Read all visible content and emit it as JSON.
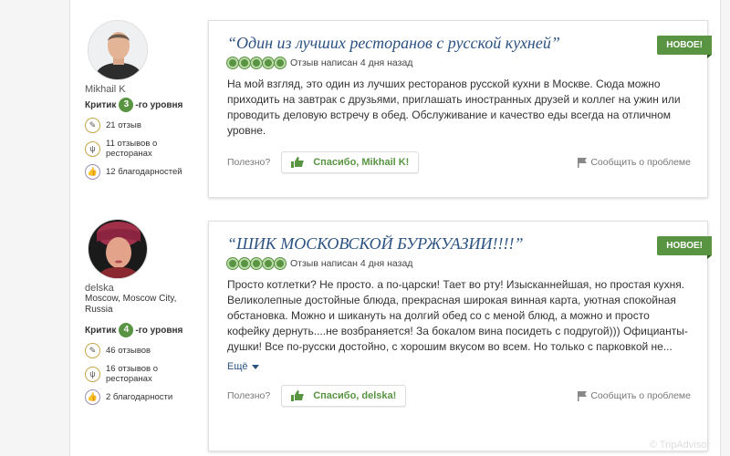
{
  "reviews": [
    {
      "member": {
        "username": "Mikhail K",
        "location": "",
        "level_prefix": "Критик",
        "level": "3",
        "level_suffix": "-го уровня",
        "stats": [
          "21 отзыв",
          "11 отзывов о ресторанах",
          "12 благодарностей"
        ]
      },
      "title": "“Один из лучших ресторанов с русской кухней”",
      "rating": 5,
      "date_text": "Отзыв написан 4 дня назад",
      "badge": "НОВОЕ!",
      "text": "На мой взгляд, это один из лучших ресторанов русской кухни в Москве. Сюда можно приходить на завтрак с друзьями, приглашать иностранных друзей и коллег на ужин или проводить деловую встречу в обед. Обслуживание и качество еды всегда на отличном уровне.",
      "more": "",
      "helpful_label": "Полезно?",
      "thanks_label": "Спасибо, Mikhail K!",
      "report_label": "Сообщить о проблеме"
    },
    {
      "member": {
        "username": "delska",
        "location": "Moscow, Moscow City, Russia",
        "level_prefix": "Критик",
        "level": "4",
        "level_suffix": "-го уровня",
        "stats": [
          "46 отзывов",
          "16 отзывов о ресторанах",
          "2 благодарности"
        ]
      },
      "title": "“ШИК МОСКОВСКОЙ БУРЖУАЗИИ!!!!”",
      "rating": 5,
      "date_text": "Отзыв написан 4 дня назад",
      "badge": "НОВОЕ!",
      "text": "Просто котлетки? Не просто. а по-царски! Тает во рту! Изысканнейшая, но простая кухня. Великолепные достойные блюда, прекрасная широкая винная карта, уютная спокойная обстановка. Можно и шикануть на долгий обед со с меной блюд, а можно и просто кофейку дернуть....не возбраняется! За бокалом вина посидеть с подругой))) Официанты-душки! Все по-русски достойно, с хорошим вкусом во всем. Но только с парковкой не...",
      "more": "Ещё",
      "helpful_label": "Полезно?",
      "thanks_label": "Спасибо, delska!",
      "report_label": "Сообщить о проблеме"
    }
  ],
  "watermark": "© TripAdvisor",
  "colors": {
    "accent": "#589442",
    "title": "#2c5282"
  }
}
